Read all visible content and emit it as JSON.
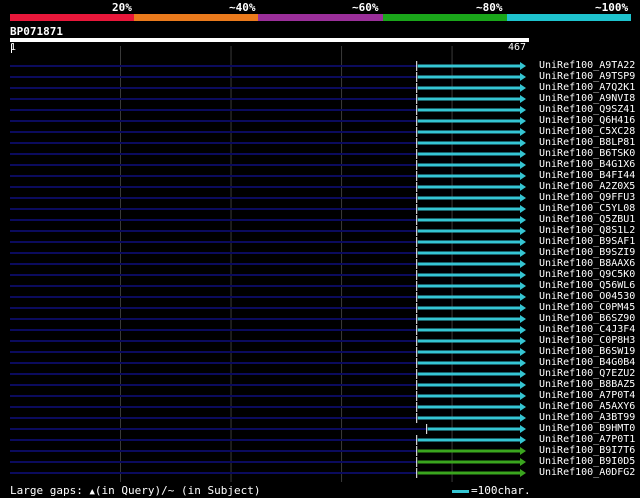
{
  "colors": {
    "background": "#000000",
    "range_colors": [
      "#e8173a",
      "#ea7a1c",
      "#9b2f9a",
      "#1aa61a",
      "#1ec3ce"
    ],
    "full_track": "#0b0b5e",
    "grid": "#3a3a3a",
    "hit_cyan": "#35c6d3",
    "hit_green": "#3aa51e",
    "query_bar": "#ffffff"
  },
  "identity_legend": {
    "labels": [
      "20%",
      "~40%",
      "~60%",
      "~80%",
      "~100%"
    ]
  },
  "query": {
    "name": "BP071871",
    "start": "1",
    "end": "467",
    "length": 467
  },
  "hits": [
    {
      "id": "UniRef100_A9TA22",
      "start": 369,
      "end": 467,
      "color": "cyan"
    },
    {
      "id": "UniRef100_A9TSP9",
      "start": 369,
      "end": 467,
      "color": "cyan"
    },
    {
      "id": "UniRef100_A7Q2K1",
      "start": 369,
      "end": 467,
      "color": "cyan"
    },
    {
      "id": "UniRef100_A9NVI8",
      "start": 369,
      "end": 467,
      "color": "cyan"
    },
    {
      "id": "UniRef100_Q9SZ41",
      "start": 369,
      "end": 467,
      "color": "cyan"
    },
    {
      "id": "UniRef100_Q6H416",
      "start": 369,
      "end": 467,
      "color": "cyan"
    },
    {
      "id": "UniRef100_C5XC28",
      "start": 369,
      "end": 467,
      "color": "cyan"
    },
    {
      "id": "UniRef100_B8LP81",
      "start": 369,
      "end": 467,
      "color": "cyan"
    },
    {
      "id": "UniRef100_B6TSK0",
      "start": 369,
      "end": 467,
      "color": "cyan"
    },
    {
      "id": "UniRef100_B4G1X6",
      "start": 369,
      "end": 467,
      "color": "cyan"
    },
    {
      "id": "UniRef100_B4FI44",
      "start": 369,
      "end": 467,
      "color": "cyan"
    },
    {
      "id": "UniRef100_A2Z0X5",
      "start": 369,
      "end": 467,
      "color": "cyan"
    },
    {
      "id": "UniRef100_Q9FFU3",
      "start": 369,
      "end": 467,
      "color": "cyan"
    },
    {
      "id": "UniRef100_C5YL08",
      "start": 369,
      "end": 467,
      "color": "cyan"
    },
    {
      "id": "UniRef100_Q5ZBU1",
      "start": 369,
      "end": 467,
      "color": "cyan"
    },
    {
      "id": "UniRef100_Q8S1L2",
      "start": 369,
      "end": 467,
      "color": "cyan"
    },
    {
      "id": "UniRef100_B9SAF1",
      "start": 369,
      "end": 467,
      "color": "cyan"
    },
    {
      "id": "UniRef100_B9SZI9",
      "start": 369,
      "end": 467,
      "color": "cyan"
    },
    {
      "id": "UniRef100_B8AAX6",
      "start": 369,
      "end": 467,
      "color": "cyan"
    },
    {
      "id": "UniRef100_Q9C5K0",
      "start": 369,
      "end": 467,
      "color": "cyan"
    },
    {
      "id": "UniRef100_Q56WL6",
      "start": 369,
      "end": 467,
      "color": "cyan"
    },
    {
      "id": "UniRef100_O04530",
      "start": 369,
      "end": 467,
      "color": "cyan"
    },
    {
      "id": "UniRef100_C0PM45",
      "start": 369,
      "end": 467,
      "color": "cyan"
    },
    {
      "id": "UniRef100_B6SZ90",
      "start": 369,
      "end": 467,
      "color": "cyan"
    },
    {
      "id": "UniRef100_C4J3F4",
      "start": 369,
      "end": 467,
      "color": "cyan"
    },
    {
      "id": "UniRef100_C0P8H3",
      "start": 369,
      "end": 467,
      "color": "cyan"
    },
    {
      "id": "UniRef100_B6SW19",
      "start": 369,
      "end": 467,
      "color": "cyan"
    },
    {
      "id": "UniRef100_B4G0B4",
      "start": 369,
      "end": 467,
      "color": "cyan"
    },
    {
      "id": "UniRef100_Q7EZU2",
      "start": 369,
      "end": 467,
      "color": "cyan"
    },
    {
      "id": "UniRef100_B8BAZ5",
      "start": 369,
      "end": 467,
      "color": "cyan"
    },
    {
      "id": "UniRef100_A7P0T4",
      "start": 369,
      "end": 467,
      "color": "cyan"
    },
    {
      "id": "UniRef100_A5AXY6",
      "start": 369,
      "end": 467,
      "color": "cyan"
    },
    {
      "id": "UniRef100_A3BT99",
      "start": 369,
      "end": 467,
      "color": "cyan"
    },
    {
      "id": "UniRef100_B9HMT0",
      "start": 378,
      "end": 467,
      "color": "cyan"
    },
    {
      "id": "UniRef100_A7P0T1",
      "start": 369,
      "end": 467,
      "color": "cyan"
    },
    {
      "id": "UniRef100_B9I7T6",
      "start": 369,
      "end": 467,
      "color": "green"
    },
    {
      "id": "UniRef100_B9I0D5",
      "start": 369,
      "end": 467,
      "color": "green"
    },
    {
      "id": "UniRef100_A0DFG2",
      "start": 369,
      "end": 467,
      "color": "green"
    }
  ],
  "footer": {
    "gaps_prefix": "Large gaps: ",
    "gaps_query": "(in Query)/",
    "gaps_subject": "~ (in Subject)",
    "scale_label": "=100char."
  }
}
